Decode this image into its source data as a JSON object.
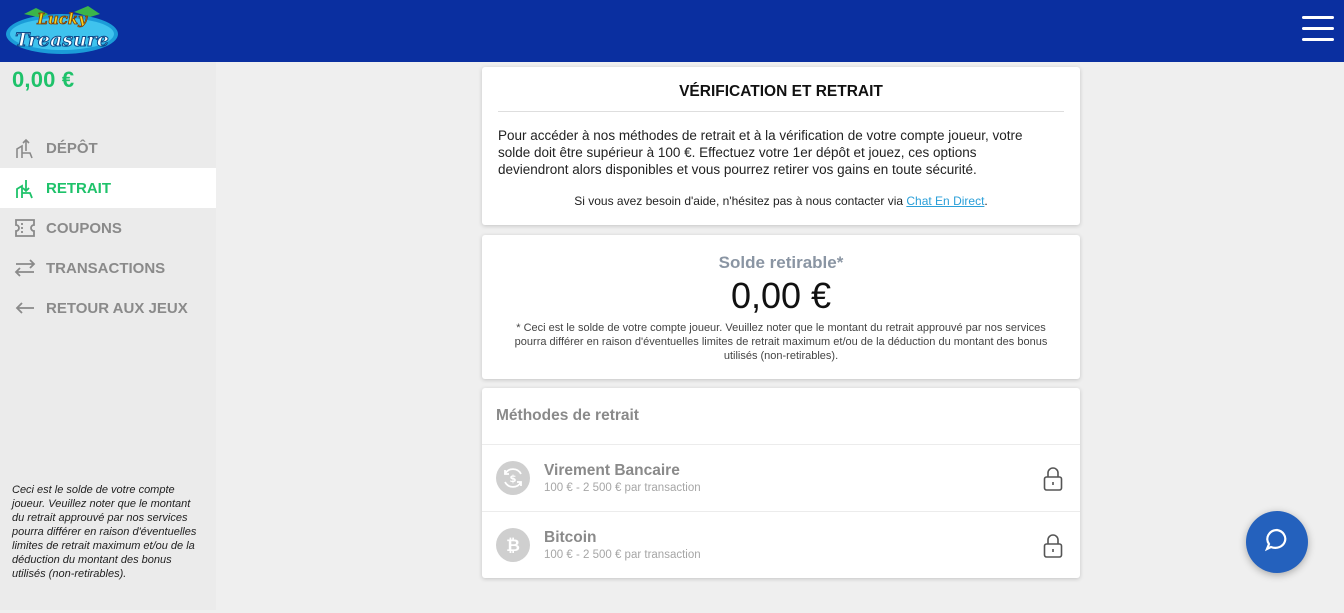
{
  "header": {
    "logo_text": "Lucky Treasure",
    "menu_icon": "hamburger-icon"
  },
  "sidebar": {
    "balance": "0,00 €",
    "items": [
      {
        "label": "DÉPÔT",
        "icon": "deposit-icon",
        "active": false
      },
      {
        "label": "RETRAIT",
        "icon": "withdraw-icon",
        "active": true
      },
      {
        "label": "COUPONS",
        "icon": "coupon-icon",
        "active": false
      },
      {
        "label": "TRANSACTIONS",
        "icon": "transactions-icon",
        "active": false
      },
      {
        "label": "RETOUR AUX JEUX",
        "icon": "back-arrow-icon",
        "active": false
      }
    ],
    "note": "Ceci est le solde de votre compte joueur. Veuillez noter que le montant du retrait approuvé par nos services pourra différer en raison d'éventuelles limites de retrait maximum et/ou de la déduction du montant des bonus utilisés (non-retirables)."
  },
  "verification": {
    "title": "VÉRIFICATION ET RETRAIT",
    "text": "Pour accéder à nos méthodes de retrait et à la vérification de votre compte joueur, votre solde doit être supérieur à 100 €. Effectuez votre 1er dépôt et jouez, ces options deviendront alors disponibles et vous pourrez retirer vos gains en toute sécurité.",
    "help_prefix": "Si vous avez besoin d'aide, n'hésitez pas à nous contacter via ",
    "help_link": "Chat En Direct",
    "help_suffix": "."
  },
  "withdrawable": {
    "label": "Solde retirable*",
    "amount": "0,00 €",
    "note": "* Ceci est le solde de votre compte joueur. Veuillez noter que le montant du retrait approuvé par nos services pourra différer en raison d'éventuelles limites de retrait maximum et/ou de la déduction du montant des bonus utilisés (non-retirables)."
  },
  "methods": {
    "title": "Méthodes de retrait",
    "items": [
      {
        "name": "Virement Bancaire",
        "range": "100 € - 2 500 € par transaction",
        "icon": "bank-transfer-icon",
        "locked": true
      },
      {
        "name": "Bitcoin",
        "range": "100 € - 2 500 € par transaction",
        "icon": "bitcoin-icon",
        "locked": true
      }
    ]
  },
  "chat": {
    "icon": "chat-bubble-icon"
  },
  "colors": {
    "header_bg": "#0a2fa0",
    "accent_green": "#1ec26a",
    "link_blue": "#2a9fd8",
    "chat_blue": "#2461bd"
  }
}
